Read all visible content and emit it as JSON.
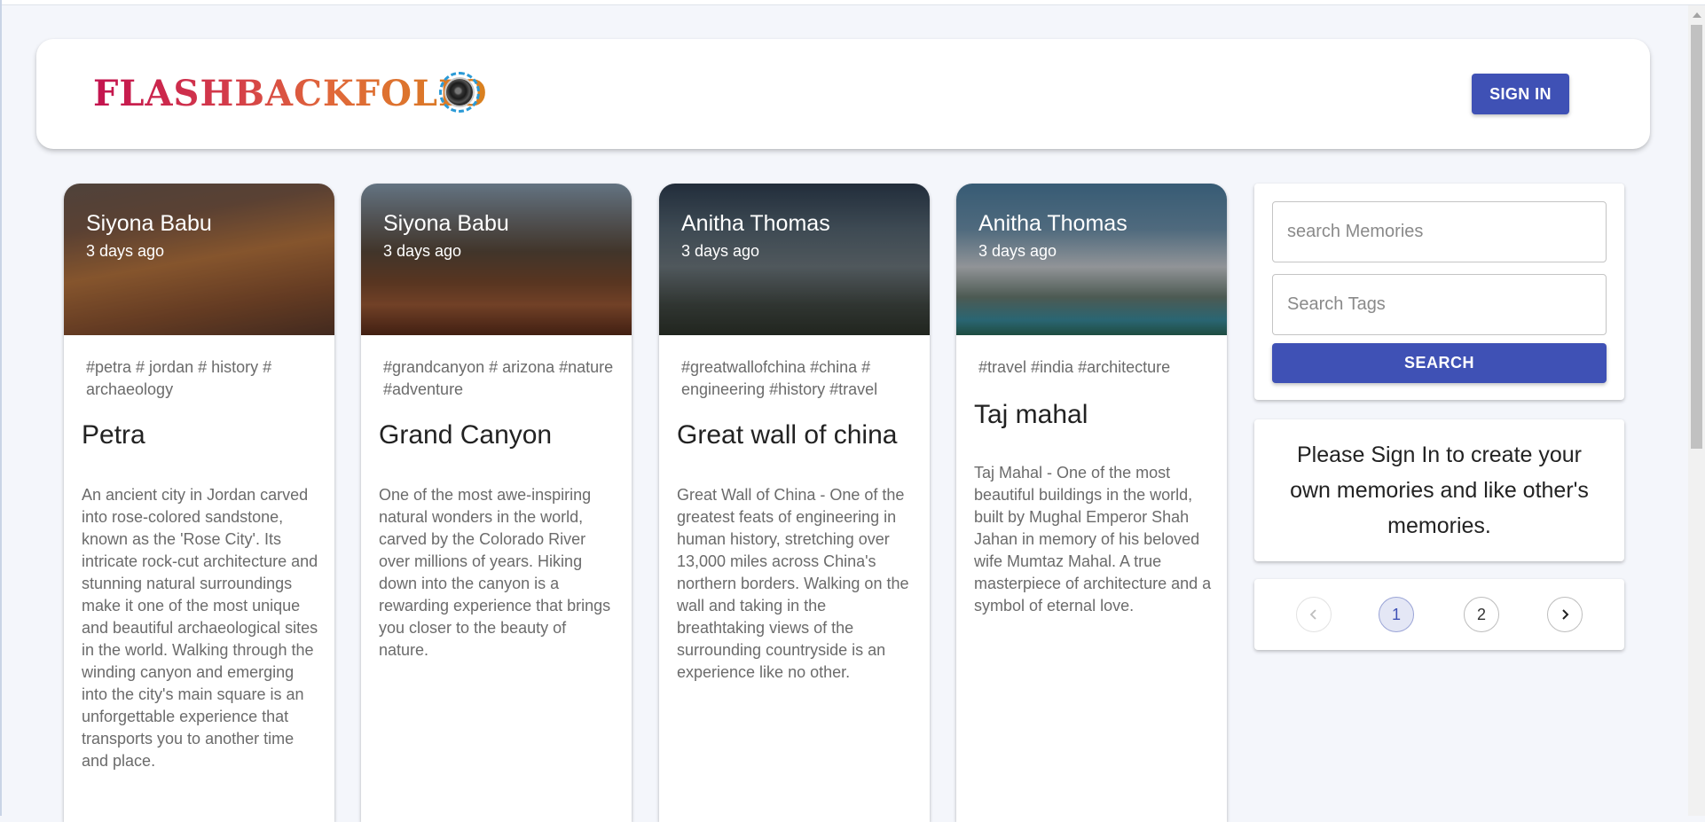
{
  "header": {
    "brand": "FLASHBACKFOLIO",
    "logo_icon": "camera-lens-icon",
    "sign_in_label": "SIGN IN"
  },
  "posts": [
    {
      "author": "Siyona Babu",
      "time": "3 days ago",
      "tags": "#petra # jordan # history # archaeology",
      "title": "Petra",
      "body": "An ancient city in Jordan carved into rose-colored sandstone, known as the 'Rose City'. Its intricate rock-cut architecture and stunning natural surroundings make it one of the most unique and beautiful archaeological sites in the world. Walking through the winding canyon and emerging into the city's main square is an unforgettable experience that transports you to another time and place."
    },
    {
      "author": "Siyona Babu",
      "time": "3 days ago",
      "tags": "#grandcanyon # arizona #nature #adventure",
      "title": "Grand Canyon",
      "body": "One of the most awe-inspiring natural wonders in the world, carved by the Colorado River over millions of years. Hiking down into the canyon is a rewarding experience that brings you closer to the beauty of nature."
    },
    {
      "author": "Anitha Thomas",
      "time": "3 days ago",
      "tags": "#greatwallofchina #china # engineering #history #travel",
      "title": "Great wall of china",
      "body": "Great Wall of China - One of the greatest feats of engineering in human history, stretching over 13,000 miles across China's northern borders. Walking on the wall and taking in the breathtaking views of the surrounding countryside is an experience like no other."
    },
    {
      "author": "Anitha Thomas",
      "time": "3 days ago",
      "tags": "#travel #india #architecture",
      "title": "Taj mahal",
      "body": "Taj Mahal - One of the most beautiful buildings in the world, built by Mughal Emperor Shah Jahan in memory of his beloved wife Mumtaz Mahal. A true masterpiece of architecture and a symbol of eternal love."
    }
  ],
  "search": {
    "memories_placeholder": "search Memories",
    "tags_placeholder": "Search Tags",
    "button_label": "SEARCH"
  },
  "info": {
    "message": "Please Sign In to create your own memories and like other's memories."
  },
  "pagination": {
    "prev_icon": "chevron-left-icon",
    "next_icon": "chevron-right-icon",
    "pages": [
      "1",
      "2"
    ],
    "current": "1"
  },
  "colors": {
    "primary": "#3f51b5",
    "brand_gradient_start": "#c3134f",
    "brand_gradient_end": "#d9811f"
  }
}
